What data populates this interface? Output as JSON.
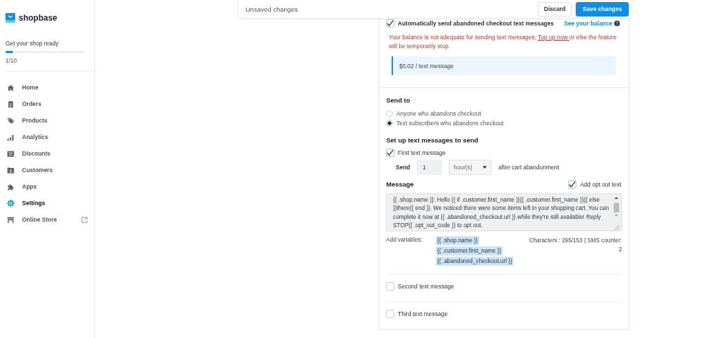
{
  "top_bar": {
    "message": "Unsaved changes",
    "buttons": [
      {
        "label": "Discard",
        "kind": "secondary"
      },
      {
        "label": "Save changes",
        "kind": "primary"
      }
    ]
  },
  "sidebar": {
    "brand": "shopbase",
    "setup": {
      "title": "Get your shop ready",
      "level": 0.1,
      "count": "1/10"
    },
    "items": [
      {
        "label": "Home",
        "selected": false,
        "external": false
      },
      {
        "label": "Orders",
        "selected": false,
        "external": false
      },
      {
        "label": "Products",
        "selected": false,
        "external": false
      },
      {
        "label": "Analytics",
        "selected": false,
        "external": false
      },
      {
        "label": "Discounts",
        "selected": false,
        "external": false
      },
      {
        "label": "Customers",
        "selected": false,
        "external": false
      },
      {
        "label": "Apps",
        "selected": false,
        "external": false
      },
      {
        "label": "Settings",
        "selected": true,
        "external": false
      },
      {
        "label": "Online Store",
        "selected": false,
        "external": true
      }
    ]
  },
  "card": {
    "auto_send": {
      "label": "Automatically send abandoned checkout text messages",
      "checked": true,
      "balance_link": "See your balance"
    },
    "warning": {
      "before": "Your balance is not adequate for sending text messages. ",
      "link": "Top up now ",
      "after": "or else the feature will be temporarily stop."
    },
    "price": "$0.02 / text message",
    "send_to": {
      "title": "Send to",
      "options": [
        {
          "label": "Anyone who abandons checkout",
          "selected": false
        },
        {
          "label": "Text subscribers who abandons checkout",
          "selected": true
        }
      ]
    },
    "setup": {
      "title": "Set up text messages to send",
      "messages": [
        {
          "label": "First text message",
          "checked": true,
          "send_label": "Send",
          "value": "1",
          "unit": "hour(s)",
          "after": "after cart abandonment",
          "message_title": "Message",
          "opt_out": {
            "label": "Add opt out text",
            "checked": true
          },
          "text": "{{ .shop.name }}: Hello {{ if .customer.first_name }}{{ .customer.first_name }}{{ else }}there{{ end }}. We noticed there were some items left in your shopping cart. You can complete it now at {{ .abandoned_checkout.url }} while they're still available! Reply STOP{{ .opt_out_code }} to opt out.",
          "variables_label": "Add variables:",
          "variables": [
            "{{ .shop.name }}",
            "{{ .customer.first_name }}",
            "{{ .abandoned_checkout.url }}"
          ],
          "counter": "Characters : 295/153 | SMS counter: 2"
        },
        {
          "label": "Second text message",
          "checked": false
        },
        {
          "label": "Third text message",
          "checked": false
        }
      ]
    }
  }
}
